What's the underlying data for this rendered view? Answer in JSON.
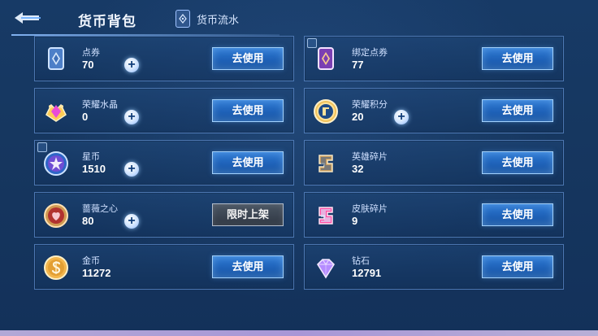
{
  "header": {
    "title": "货币背包",
    "flow_label": "货币流水"
  },
  "items": {
    "left": [
      {
        "name": "点券",
        "amount": "70",
        "button": "去使用"
      },
      {
        "name": "荣耀水晶",
        "amount": "0",
        "button": "去使用"
      },
      {
        "name": "星币",
        "amount": "1510",
        "button": "去使用"
      },
      {
        "name": "蔷薇之心",
        "amount": "80",
        "button": "限时上架"
      },
      {
        "name": "金币",
        "amount": "11272",
        "button": "去使用"
      }
    ],
    "right": [
      {
        "name": "绑定点券",
        "amount": "77",
        "button": "去使用"
      },
      {
        "name": "荣耀积分",
        "amount": "20",
        "button": "去使用"
      },
      {
        "name": "英雄碎片",
        "amount": "32",
        "button": "去使用"
      },
      {
        "name": "皮肤碎片",
        "amount": "9",
        "button": "去使用"
      },
      {
        "name": "钻石",
        "amount": "12791",
        "button": "去使用"
      }
    ]
  },
  "icons": {
    "back": "back-arrow-icon",
    "flow": "ledger-icon",
    "voucher": "voucher-card-icon",
    "bound_voucher": "bound-voucher-card-icon",
    "crystal": "crystal-icon",
    "honor_points": "honor-points-badge-icon",
    "star_coin": "star-coin-icon",
    "hero_fragment": "hero-fragment-icon",
    "rose_heart": "rose-heart-coin-icon",
    "skin_fragment": "skin-fragment-icon",
    "gold_coin": "gold-coin-icon",
    "diamond": "diamond-icon"
  },
  "colors": {
    "accent": "#2f7bd6",
    "panel": "#163760",
    "button_dark": "#3b4451"
  }
}
